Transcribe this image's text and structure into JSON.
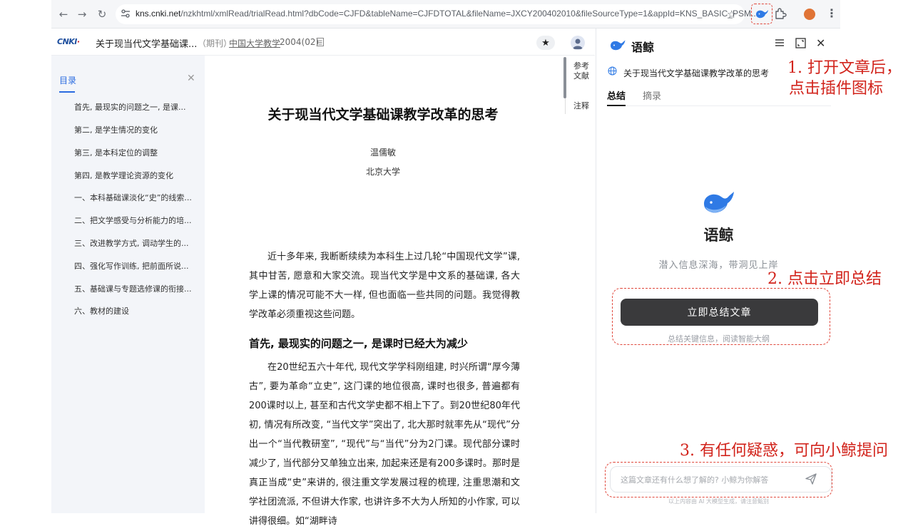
{
  "browser": {
    "url_domain": "kns.cnki.net",
    "url_rest": "/nzkhtml/xmlRead/trialRead.html?dbCode=CJFD&tableName=CJFDTOTAL&fileName=JXCY200402010&fileSourceType=1&appId=KNS_BASIC_PSM..."
  },
  "site_header": {
    "title": "关于现当代文学基础课...",
    "type": "（期刊）",
    "journal": "中国大学教学",
    "issue": "2004(02)"
  },
  "toc": {
    "title": "目录",
    "items": [
      "首先, 最现实的问题之一, 是课...",
      "第二, 是学生情况的变化",
      "第三, 是本科定位的调整",
      "第四, 是教学理论资源的变化",
      "一、本科基础课淡化“史”的线索...",
      "二、把文学感受与分析能力的培...",
      "三、改进教学方式, 调动学生的...",
      "四、强化写作训练, 把前面所说...",
      "五、基础课与专题选修课的衔接...",
      "六、教材的建设"
    ]
  },
  "article": {
    "title": "关于现当代文学基础课教学改革的思考",
    "author": "温儒敏",
    "affiliation": "北京大学",
    "para1": "近十多年来, 我断断续续为本科生上过几轮“中国现代文学”课, 其中甘苦, 愿意和大家交流。现当代文学是中文系的基础课, 各大学上课的情况可能不大一样, 但也面临一些共同的问题。我觉得教学改革必须重视这些问题。",
    "heading": "首先, 最现实的问题之一, 是课时已经大为减少",
    "para2": "在20世纪五六十年代, 现代文学学科刚组建, 时兴所谓“厚今薄古”, 要为革命“立史”, 这门课的地位很高, 课时也很多, 普遍都有200课时以上, 甚至和古代文学史都不相上下了。到20世纪80年代初, 情况有所改变, “当代文学”突出了, 北大那时就率先从“现代”分出一个“当代教研室”, “现代”与“当代”分为2门课。现代部分课时减少了, 当代部分又单独立出来, 加起来还是有200多课时。那时是真正当成“史”来讲的, 很注重文学发展过程的梳理, 注重思潮和文学社团流派, 不但讲大作家, 也讲许多不大为人所知的小作家, 可以讲得很细。如“湖畔诗"
  },
  "rail": {
    "ref": "参考文献",
    "note": "注释"
  },
  "panel": {
    "name": "语鲸",
    "article_title": "关于现当代文学基础课教学改革的思考",
    "tab_summary": "总结",
    "tab_excerpt": "摘录",
    "brand": "语鲸",
    "slogan": "潜入信息深海，带洞见上岸",
    "summarize_button": "立即总结文章",
    "summarize_sub": "总结关键信息，阅读智能大纲",
    "ask_placeholder": "这篇文章还有什么想了解的? 小鲸为你解答",
    "footnote": "以上内容由 AI 大模型生成，请注意甄别"
  },
  "annotations": {
    "step1_line1": "1. 打开文章后，",
    "step1_line2": "点击插件图标",
    "step2": "2. 点击立即总结",
    "step3": "3. 有任何疑惑，可向小鲸提问"
  },
  "colors": {
    "accent": "#2a6be0",
    "highlight": "#e0473b",
    "annotation": "#d2241c",
    "button": "#3a3a3c",
    "whale": "#2f7ae5"
  }
}
